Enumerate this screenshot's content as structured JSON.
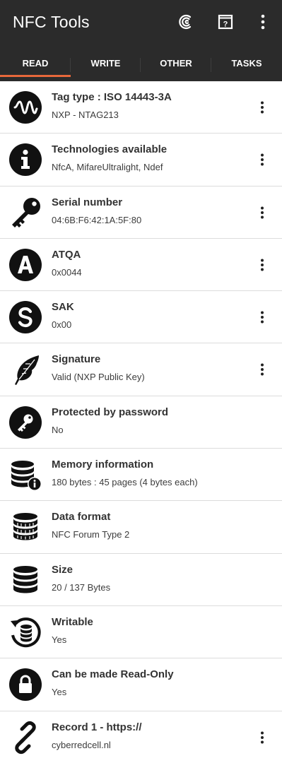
{
  "app": {
    "title": "NFC Tools",
    "actions": [
      {
        "icon": "scan-waves-icon"
      },
      {
        "icon": "help-book-icon"
      },
      {
        "icon": "overflow-menu-icon"
      }
    ]
  },
  "tabs": [
    {
      "label": "READ",
      "selected": true
    },
    {
      "label": "WRITE",
      "selected": false
    },
    {
      "label": "OTHER",
      "selected": false
    },
    {
      "label": "TASKS",
      "selected": false
    }
  ],
  "colors": {
    "appbar": "#2b2b2b",
    "tab_indicator": "#e8683b",
    "icon": "#111111",
    "divider": "#dcdcdc"
  },
  "items": [
    {
      "label": "Tag type : ISO 14443-3A",
      "value": "NXP - NTAG213",
      "icon": "wave-icon",
      "has_menu": true
    },
    {
      "label": "Technologies available",
      "value": "NfcA, MifareUltralight, Ndef",
      "icon": "info-icon",
      "has_menu": true
    },
    {
      "label": "Serial number",
      "value": "04:6B:F6:42:1A:5F:80",
      "icon": "key-icon",
      "has_menu": true
    },
    {
      "label": "ATQA",
      "value": "0x0044",
      "icon": "letter-a-icon",
      "has_menu": true
    },
    {
      "label": "SAK",
      "value": "0x00",
      "icon": "letter-s-icon",
      "has_menu": true
    },
    {
      "label": "Signature",
      "value": "Valid (NXP Public Key)",
      "icon": "feather-icon",
      "has_menu": true
    },
    {
      "label": "Protected by password",
      "value": "No",
      "icon": "password-key-icon",
      "has_menu": false
    },
    {
      "label": "Memory information",
      "value": "180 bytes : 45 pages (4 bytes each)",
      "icon": "database-info-icon",
      "has_menu": false
    },
    {
      "label": "Data format",
      "value": "NFC Forum Type 2",
      "icon": "database-format-icon",
      "has_menu": false
    },
    {
      "label": "Size",
      "value": "20 / 137 Bytes",
      "icon": "database-icon",
      "has_menu": false
    },
    {
      "label": "Writable",
      "value": "Yes",
      "icon": "database-sync-icon",
      "has_menu": false
    },
    {
      "label": "Can be made Read-Only",
      "value": "Yes",
      "icon": "lock-icon",
      "has_menu": false
    },
    {
      "label": "Record 1 - https://",
      "value": "cyberredcell.nl",
      "icon": "link-icon",
      "has_menu": true
    }
  ]
}
